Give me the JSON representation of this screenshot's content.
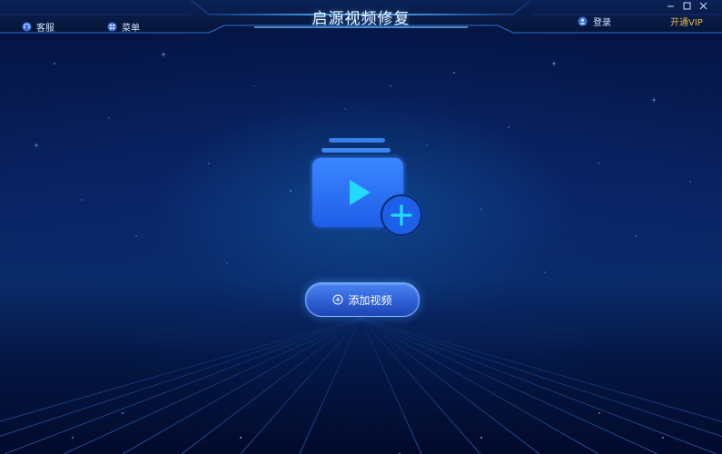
{
  "app": {
    "title": "启源视频修复"
  },
  "toolbar": {
    "service_label": "客服",
    "menu_label": "菜单",
    "login_label": "登录",
    "vip_label": "开通VIP"
  },
  "window_controls": {
    "minimize": "—",
    "maximize": "□",
    "close": "✕"
  },
  "main": {
    "add_video_label": "添加视频"
  },
  "icons": {
    "service": "headset-icon",
    "menu": "grid-menu-icon",
    "login": "user-icon",
    "hero": "video-add-icon",
    "add": "plus-circle-icon"
  },
  "colors": {
    "accent": "#2f7bff",
    "vip": "#e6b84a",
    "button": "#3a6fe0"
  }
}
